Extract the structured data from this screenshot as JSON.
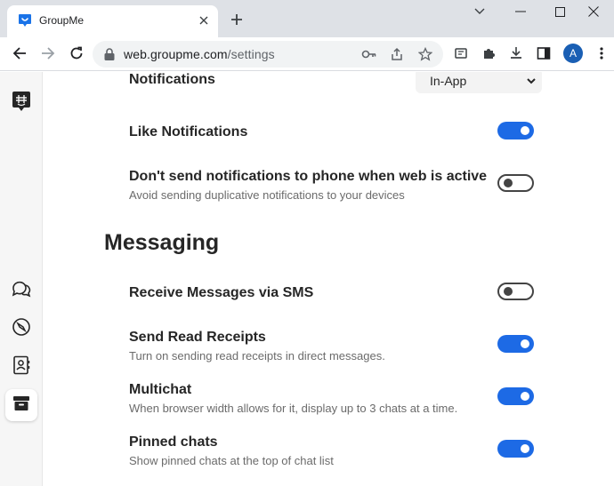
{
  "browser": {
    "tab_title": "GroupMe",
    "url_host": "web.groupme.com",
    "url_path": "/settings",
    "avatar_letter": "A",
    "accent_color": "#1a5fb4"
  },
  "app": {
    "sidebar": {
      "items": [
        {
          "icon": "groupme-logo-icon"
        },
        {
          "icon": "chats-icon"
        },
        {
          "icon": "discover-icon"
        },
        {
          "icon": "contacts-icon"
        },
        {
          "icon": "archive-icon",
          "active": true
        }
      ]
    },
    "notifications": {
      "partial_title": "Notifications",
      "select_value": "In-App",
      "like_notifications": {
        "label": "Like Notifications",
        "enabled": true
      },
      "no_phone_when_web": {
        "label": "Don't send notifications to phone when web is active",
        "description": "Avoid sending duplicative notifications to your devices",
        "enabled": false
      }
    },
    "messaging": {
      "title": "Messaging",
      "sms": {
        "label": "Receive Messages via SMS",
        "enabled": false
      },
      "read_receipts": {
        "label": "Send Read Receipts",
        "description": "Turn on sending read receipts in direct messages.",
        "enabled": true
      },
      "multichat": {
        "label": "Multichat",
        "description": "When browser width allows for it, display up to 3 chats at a time.",
        "enabled": true
      },
      "pinned_chats": {
        "label": "Pinned chats",
        "description": "Show pinned chats at the top of chat list",
        "enabled": true
      }
    },
    "toggle_on_color": "#1d6ae5",
    "toggle_off_color": "#444444"
  }
}
